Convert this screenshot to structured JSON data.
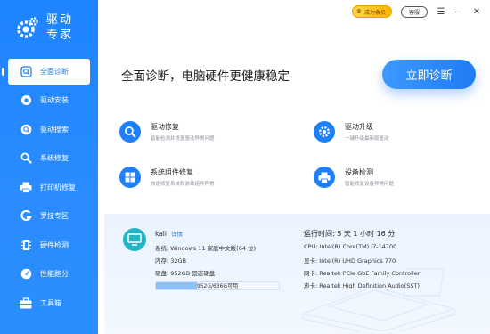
{
  "brand": {
    "line1": "驱动",
    "line2": "专家"
  },
  "nav": [
    {
      "label": "全面诊断",
      "icon": "diagnose-icon",
      "active": true
    },
    {
      "label": "驱动安装",
      "icon": "driver-install-icon"
    },
    {
      "label": "驱动搜索",
      "icon": "search-icon"
    },
    {
      "label": "系统修复",
      "icon": "wrench-icon"
    },
    {
      "label": "打印机修复",
      "icon": "printer-icon"
    },
    {
      "label": "罗技专区",
      "icon": "logitech-icon"
    },
    {
      "label": "硬件检测",
      "icon": "chip-icon"
    },
    {
      "label": "性能跑分",
      "icon": "gauge-icon"
    },
    {
      "label": "工具箱",
      "icon": "toolbox-icon"
    }
  ],
  "topbar": {
    "vip_label": "成为会员",
    "service_label": "客服"
  },
  "headline": "全面诊断，电脑硬件更健康稳定",
  "diag_button": "立即诊断",
  "features": [
    {
      "title": "驱动修复",
      "desc": "智能检测并修复驱动异常问题",
      "icon": "search-icon"
    },
    {
      "title": "驱动升级",
      "desc": "一键升级最新版驱动",
      "icon": "gear-icon"
    },
    {
      "title": "系统组件修复",
      "desc": "快速修复系统和游戏组件异常",
      "icon": "windows-icon"
    },
    {
      "title": "设备检测",
      "desc": "智能修复设备异常问题",
      "icon": "printer-icon"
    }
  ],
  "system": {
    "user": "kali",
    "detail_link": "详情",
    "os": "系统:  Windows 11 家庭中文版(64 位)",
    "memory": "内存:  32GB",
    "disk": "硬盘:  952GB 固态硬盘",
    "disk_usage": "952G/636G可用",
    "disk_used_fraction": 0.33
  },
  "hardware": {
    "runtime": "运行时间:  5 天 1 小时 16 分",
    "cpu": "CPU:  Intel(R) Core(TM) i7-14700",
    "gpu": "显卡:  Intel(R) UHD Graphics 770",
    "nic": "网卡:  Realtek PCIe GbE Family Controller",
    "sound": "声卡:  Realtek High Definition Audio(SST)"
  },
  "colors": {
    "primary": "#1e80f8",
    "sidebar": "#2a8cff",
    "panel": "#eaf3ff",
    "vip": "#ffc21a"
  }
}
